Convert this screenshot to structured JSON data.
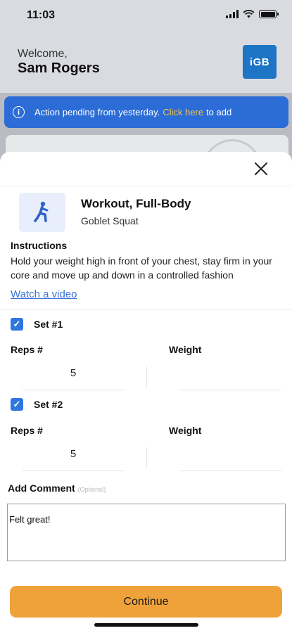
{
  "status_bar": {
    "time": "11:03"
  },
  "header": {
    "welcome": "Welcome,",
    "user_name": "Sam Rogers",
    "logo_text": "iGB"
  },
  "banner": {
    "text": "Action pending from yesterday.",
    "link": "Click here",
    "suffix": "to add"
  },
  "exercise": {
    "title": "Workout, Full-Body",
    "subtitle": "Goblet Squat",
    "instructions_heading": "Instructions",
    "instructions_text": "Hold your weight high in front of your chest, stay firm in your core and move up and down in a controlled fashion",
    "video_link": "Watch a video"
  },
  "sets": [
    {
      "label": "Set #1",
      "checked": true,
      "reps_label": "Reps #",
      "weight_label": "Weight",
      "reps": "5",
      "weight": ""
    },
    {
      "label": "Set #2",
      "checked": true,
      "reps_label": "Reps #",
      "weight_label": "Weight",
      "reps": "5",
      "weight": ""
    }
  ],
  "comment": {
    "heading": "Add Comment",
    "optional": "(Optional)",
    "value": "Felt great!"
  },
  "buttons": {
    "continue": "Continue",
    "close": "✕"
  },
  "colors": {
    "banner": "#2c6cd6",
    "link_highlight": "#f5c451",
    "checkbox": "#2f77e0",
    "continue": "#f0a23a",
    "logo": "#1e74c5"
  }
}
